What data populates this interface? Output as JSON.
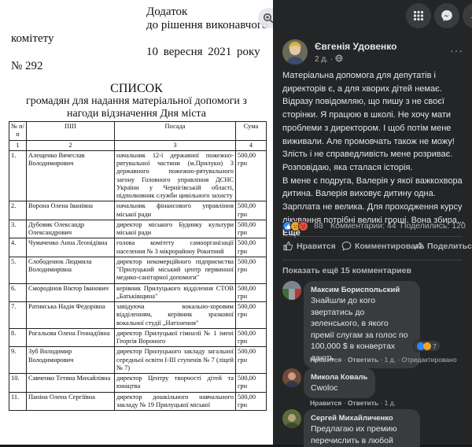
{
  "document": {
    "annex_line1": "Додаток",
    "annex_line2": "до рішення виконавчого",
    "annex_line3": "комітету",
    "date": "10 вересня 2021 року",
    "number": "№ 292",
    "title": "СПИСОК",
    "subtitle_line1": "громадян для надання матеріальної допомоги з",
    "subtitle_line2": "нагоди відзначення Дня міста",
    "columns": [
      "№ п/п",
      "ПІП",
      "Посада",
      "Сума"
    ],
    "column_numbers": [
      "1",
      "2",
      "3",
      "4"
    ],
    "rows": [
      {
        "n": "1.",
        "name": "Алещенко Вячеслав Володимирович",
        "position": "начальник 12-ї державної пожежно-рятувальної частини (м.Прилуки) 3 державного пожежно-рятувального загону Головного управління ДСНС України у Чернігівській області, підполковник служби цивільного захисту",
        "sum": "500,00 грн"
      },
      {
        "n": "2.",
        "name": "Ворона Олена Іванівна",
        "position": "начальник фінансового управління міської ради",
        "sum": "500,00 грн"
      },
      {
        "n": "3.",
        "name": "Дубовик Олександр Олександрович",
        "position": "директор міського Будинку культури міської ради",
        "sum": "500,00 грн"
      },
      {
        "n": "4.",
        "name": "Чумаченко Анна Леонідівна",
        "position": "голова комітету самоорганізації населення № 3 мікрорайону Рокитний",
        "sum": "500,00 грн"
      },
      {
        "n": "5.",
        "name": "Слободенюк Людмила Володимирівна",
        "position": "директор некомерційного підприємства \"Прилуцький міський центр первинної медико-санітарної допомоги\"",
        "sum": "500,00 грн"
      },
      {
        "n": "6.",
        "name": "Смородінов Віктор Іванович",
        "position": "керівник Прилуцького відділення СТОВ „Батьківщина\"",
        "sum": "500,00 грн"
      },
      {
        "n": "7.",
        "name": "Ратинська Надія Федорівна",
        "position": "завідуюча вокально-хоровим відділенням, керівник зразкової вокальної студії „Натхнення\"",
        "sum": "500,00 грн"
      },
      {
        "n": "8.",
        "name": "Рогальова Олена Геннадіївна",
        "position": "директор Прилуцької гімназії № 1 імені Георгія Вороного",
        "sum": "500,00 грн"
      },
      {
        "n": "9.",
        "name": "Зуб Володимир Володимирович",
        "position": "директор Прилуцького закладу загальної середньої освіти І-ІІІ ступенів № 7 (ліцей № 7)",
        "sum": "500,00 грн"
      },
      {
        "n": "10.",
        "name": "Савченко Тетяна Михайлівна",
        "position": "директор Центру творчості дітей та юнацтва",
        "sum": "500,00 грн"
      },
      {
        "n": "11.",
        "name": "Паніна Олена Сергіївна",
        "position": "директор дошкільного навчального закладу № 19 Прилуцької міської",
        "sum": "500,00 грн"
      }
    ]
  },
  "post": {
    "author": "Євгенія Удовенко",
    "time": "2 д.",
    "text_paragraphs": [
      "Матеріальна допомога для депутатів і директорів є, а для хворих дітей немає. Відразу повідомляю, що пишу з не своєї сторінки. Я працюю в школі. Не хочу мати проблеми з директором. І щоб потім мене виживали. Але промовчать також не можу! Злість і не справедливість мене розриває. Розповідаю, яка сталася історія.",
      "В мене є подруга, Валерія у якої важкохвора дитина. Валерія виховує дитину одна. Зарплата не велика. Для проходження курсу лікування потрібні великі гроші. Вона збира..."
    ],
    "see_more": "Ещё",
    "reactions_count": "88",
    "comments_count": "Комментарии: 44",
    "shares_count": "Поделились: 120",
    "like_label": "Нравится",
    "comment_label": "Комментировать",
    "share_label": "Поделиться",
    "prev_comments": "Показать ещё 15 комментариев"
  },
  "comments": [
    {
      "name": "Максим Бориспольский",
      "text": "Знайшли до кого звертатись до зеленського, в якого премії слугам за голос по 100,000 $ в конвертах дають",
      "like": "Нравится",
      "reply": "Ответить",
      "time": "1 д.",
      "edited": "Отредактировано",
      "reactions": "7"
    },
    {
      "name": "Микола Коваль",
      "text": "Cwoloc",
      "like": "Нравится",
      "reply": "Ответить",
      "time": "1 д."
    },
    {
      "name": "Сергей Михайличенко",
      "text": "Предлагаю их премию перечислить в любой"
    }
  ],
  "colors": {
    "panel_bg": "#242526",
    "bubble_bg": "#3a3b3c",
    "text": "#e4e6eb",
    "muted": "#b0b3b8",
    "like_blue": "#2d88ff"
  }
}
